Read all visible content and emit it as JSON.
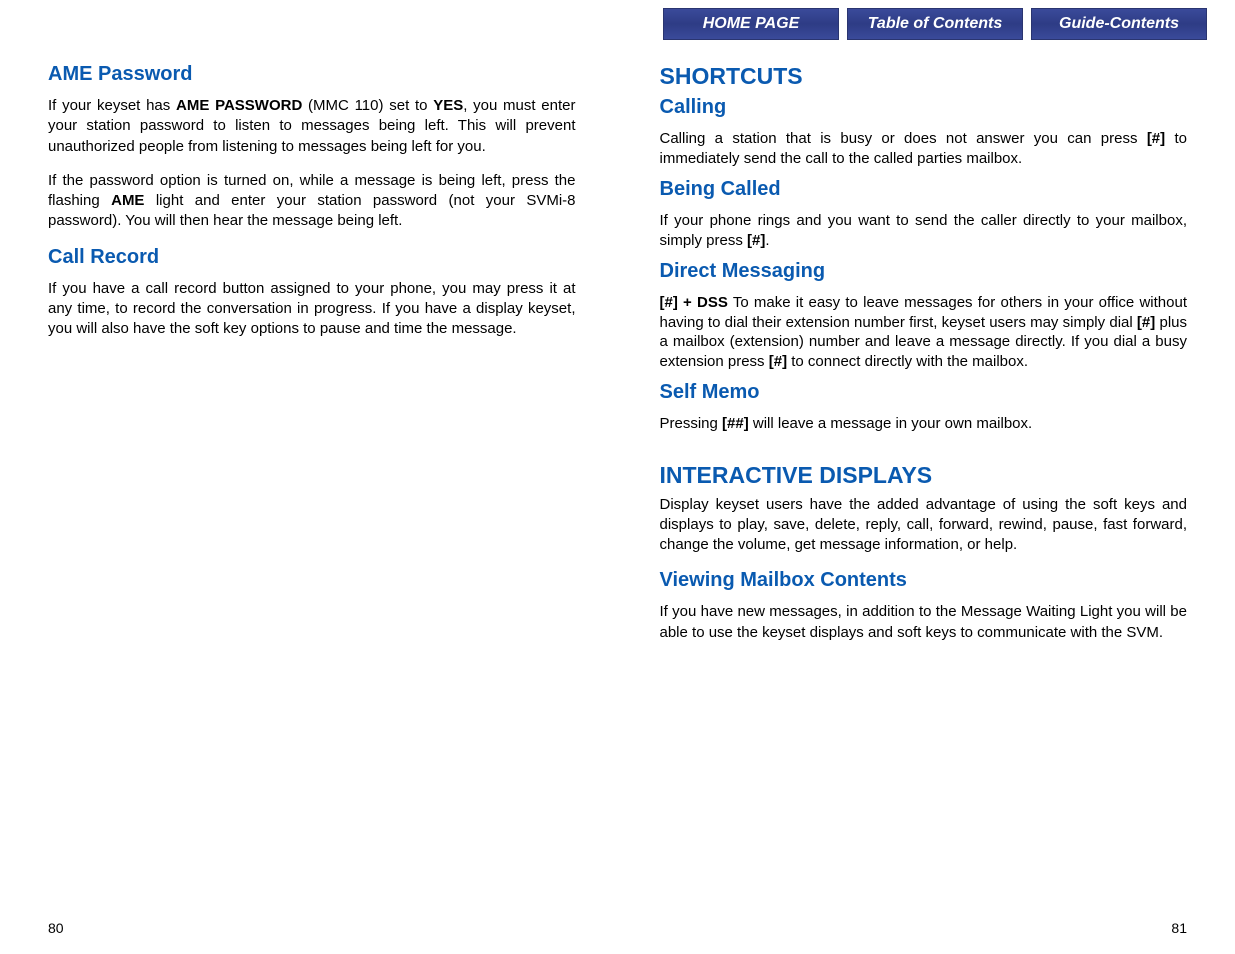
{
  "nav": {
    "home": "HOME PAGE",
    "toc": "Table of Contents",
    "guide": "Guide-Contents"
  },
  "left": {
    "h1": "AME Password",
    "p1a": "If your keyset has ",
    "p1b": "AME PASSWORD",
    "p1c": " (MMC 110) set to ",
    "p1d": "YES",
    "p1e": ", you must enter your station password to listen to messages being left. This will prevent unauthorized people from listening to messages being left for you.",
    "p2a": "If the password option is turned on, while a message is being left, press the flashing ",
    "p2b": "AME",
    "p2c": " light and enter your station password (not your SVMi-8 password). You will then hear the message being left.",
    "h2": "Call Record",
    "p3": "If you have a call record button assigned to your phone, you may press it at any time, to record the conversation in progress. If you have a display keyset, you will also have the soft key options to pause and time the message.",
    "page": "80"
  },
  "right": {
    "h_shortcuts": "SHORTCUTS",
    "h_calling": "Calling",
    "calling_a": "Calling a station that is busy or does not answer you can press ",
    "calling_b": "[#]",
    "calling_c": " to immediately send the call to the called parties mailbox.",
    "h_being": "Being Called",
    "being_a": "If your phone rings and you want to send the caller directly to your mailbox, simply press ",
    "being_b": "[#]",
    "being_c": ".",
    "h_direct": "Direct Messaging",
    "direct_a": "[#] + DSS",
    "direct_b": "  To make it easy to leave messages for others in your office without having to dial their extension number first, keyset users may simply dial ",
    "direct_c": "[#]",
    "direct_d": " plus a mailbox (extension) number and leave a message directly. If you dial a busy extension press ",
    "direct_e": "[#]",
    "direct_f": " to connect directly with the mailbox.",
    "h_self": "Self Memo",
    "self_a": "Pressing ",
    "self_b": "[##]",
    "self_c": " will leave a message in your own mailbox.",
    "h_interactive": "INTERACTIVE DISPLAYS",
    "interactive_p": "Display keyset users have the added advantage of using the soft keys and displays to play, save, delete, reply, call, forward, rewind, pause, fast forward, change the volume, get message information, or help.",
    "h_viewing": "Viewing Mailbox Contents",
    "viewing_p": "If you have new messages, in addition to the Message Waiting Light you will be able to use the keyset displays and soft keys to communicate with the SVM.",
    "page": "81"
  }
}
